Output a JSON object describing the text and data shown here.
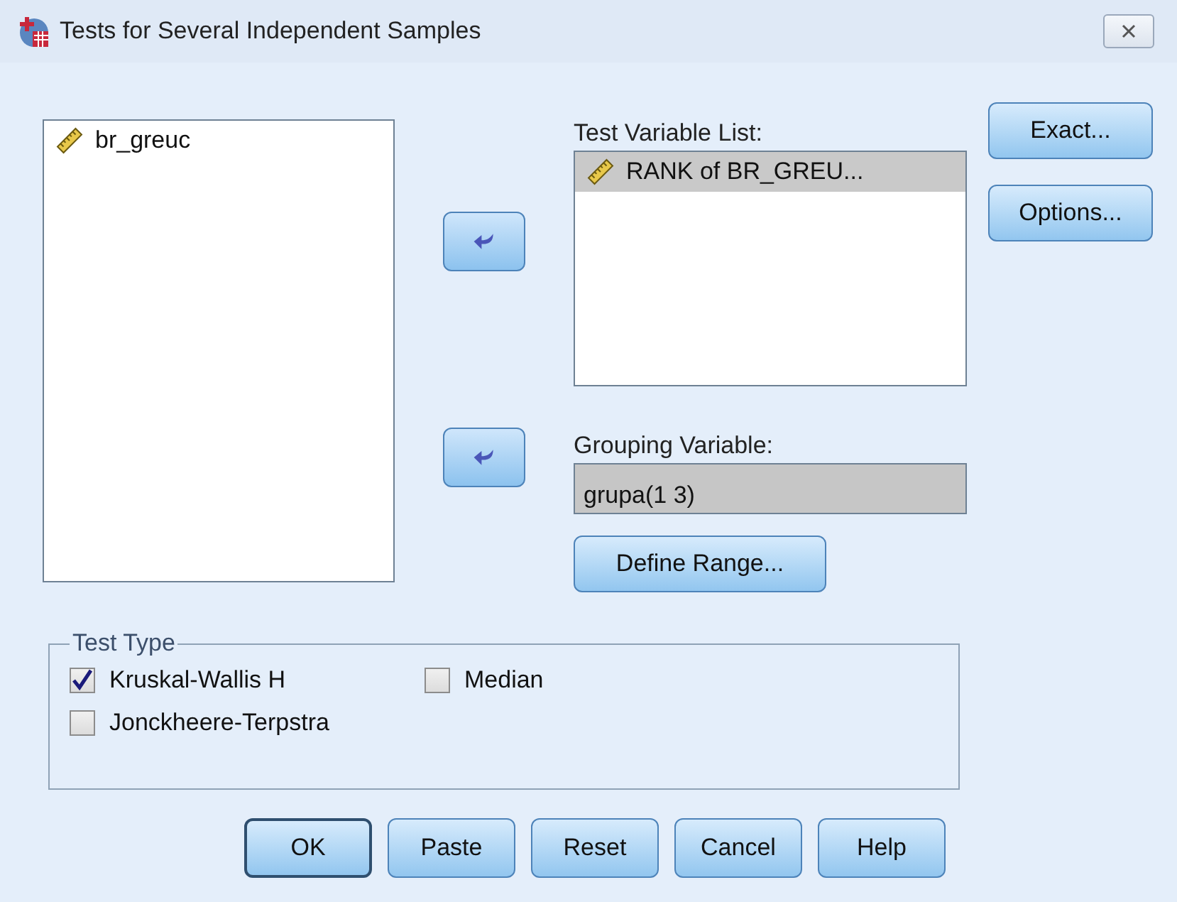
{
  "window": {
    "title": "Tests for Several Independent Samples"
  },
  "source_list": {
    "items": [
      {
        "label": "br_greuc",
        "selected": false
      }
    ]
  },
  "test_variable_list": {
    "label": "Test Variable List:",
    "items": [
      {
        "label": "RANK of BR_GREU...",
        "selected": true
      }
    ]
  },
  "grouping_variable": {
    "label": "Grouping Variable:",
    "value": "grupa(1 3)"
  },
  "define_range_button": "Define Range...",
  "side_buttons": [
    "Exact...",
    "Options..."
  ],
  "test_type": {
    "title": "Test Type",
    "options": [
      {
        "label": "Kruskal-Wallis H",
        "checked": true
      },
      {
        "label": "Median",
        "checked": false
      },
      {
        "label": "Jonckheere-Terpstra",
        "checked": false
      }
    ]
  },
  "buttons": [
    {
      "label": "OK",
      "default": true
    },
    {
      "label": "Paste",
      "default": false
    },
    {
      "label": "Reset",
      "default": false
    },
    {
      "label": "Cancel",
      "default": false
    },
    {
      "label": "Help",
      "default": false
    }
  ]
}
